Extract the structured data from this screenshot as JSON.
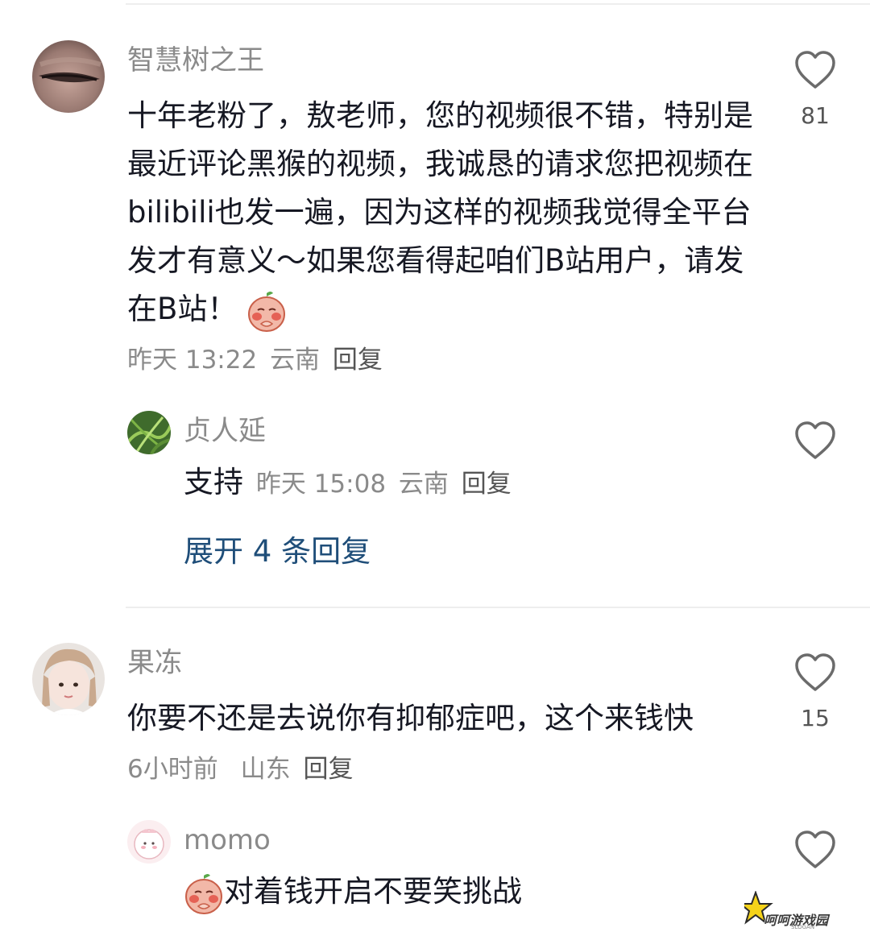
{
  "comments": [
    {
      "username": "智慧树之王",
      "text": "十年老粉了，敖老师，您的视频很不错，特别是最近评论黑猴的视频，我诚恳的请求您把视频在bilibili也发一遍，因为这样的视频我觉得全平台发才有意义～如果您看得起咱们B站用户，请发在B站！",
      "time": "昨天 13:22",
      "location": "云南",
      "reply_label": "回复",
      "likes": "81",
      "replies": [
        {
          "username": "贞人延",
          "text": "支持",
          "time": "昨天 15:08",
          "location": "云南",
          "reply_label": "回复"
        }
      ],
      "expand_label": "展开 4 条回复"
    },
    {
      "username": "果冻",
      "text": "你要不还是去说你有抑郁症吧，这个来钱快",
      "time": "6小时前",
      "location": "山东",
      "reply_label": "回复",
      "likes": "15",
      "replies": [
        {
          "username": "momo",
          "text": "对着钱开启不要笑挑战"
        }
      ]
    }
  ],
  "watermark": {
    "text": "呵呵游戏园",
    "sub": "SLOGAN"
  },
  "icons": {
    "like": "heart-outline-icon",
    "emoji": "peach-emoji-icon"
  },
  "colors": {
    "text": "#161823",
    "meta": "#8a8a8a",
    "expand": "#1f4e79"
  }
}
